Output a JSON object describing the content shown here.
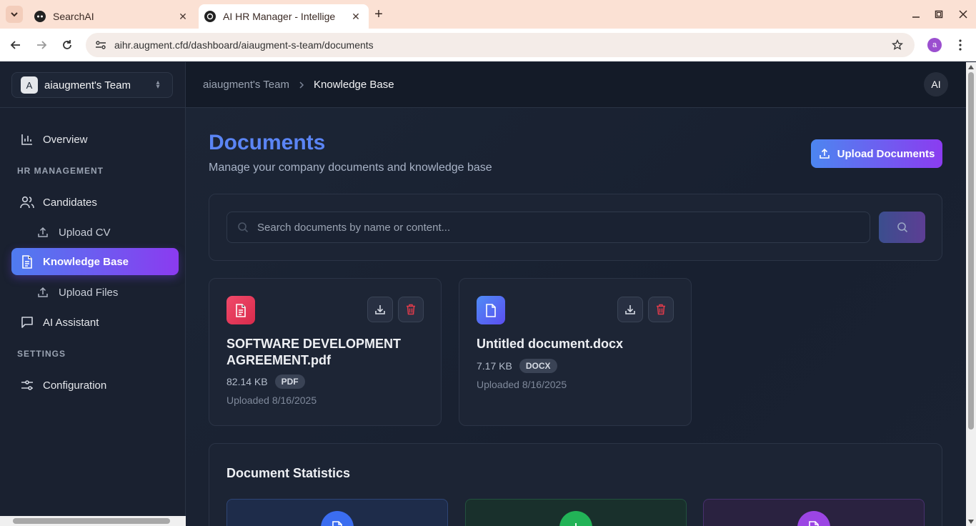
{
  "browser": {
    "tabs": [
      {
        "title": "SearchAI",
        "active": false
      },
      {
        "title": "AI HR Manager - Intellige",
        "active": true
      }
    ],
    "url": "aihr.augment.cfd/dashboard/aiaugment-s-team/documents",
    "profile_initial": "a"
  },
  "team": {
    "initial": "A",
    "name": "aiaugment's Team"
  },
  "sidebar": {
    "overview": "Overview",
    "hr_section": "HR MANAGEMENT",
    "candidates": "Candidates",
    "upload_cv": "Upload CV",
    "knowledge_base": "Knowledge Base",
    "upload_files": "Upload Files",
    "ai_assistant": "AI Assistant",
    "settings_section": "SETTINGS",
    "configuration": "Configuration"
  },
  "header": {
    "breadcrumb": [
      "aiaugment's Team",
      "Knowledge Base"
    ],
    "avatar": "AI"
  },
  "page": {
    "title": "Documents",
    "subtitle": "Manage your company documents and knowledge base",
    "upload_button": "Upload Documents",
    "search_placeholder": "Search documents by name or content..."
  },
  "documents": [
    {
      "name": "SOFTWARE DEVELOPMENT AGREEMENT.pdf",
      "size": "82.14 KB",
      "type": "PDF",
      "uploaded": "Uploaded 8/16/2025",
      "icon_color": "#e8385a"
    },
    {
      "name": "Untitled document.docx",
      "size": "7.17 KB",
      "type": "DOCX",
      "uploaded": "Uploaded 8/16/2025",
      "icon_color": "#4f74f2"
    }
  ],
  "stats": {
    "title": "Document Statistics"
  },
  "colors": {
    "accent_start": "#4f7cf0",
    "accent_end": "#8b3bf0",
    "title_blue": "#5b85f5",
    "delete_red": "#e03b4b"
  }
}
